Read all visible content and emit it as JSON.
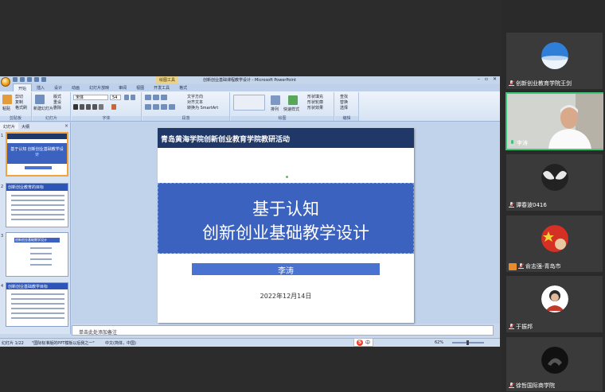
{
  "powerpoint": {
    "window_title": "创新创业基础课程教学设计 - Microsoft PowerPoint",
    "context_tab": "绘图工具",
    "window_controls": [
      "–",
      "▫",
      "✕"
    ],
    "tabs": [
      "开始",
      "插入",
      "设计",
      "动画",
      "幻灯片放映",
      "审阅",
      "视图",
      "开发工具",
      "格式"
    ],
    "active_tab": "开始",
    "ribbon": {
      "paste": "粘贴",
      "cut": "剪切",
      "copy": "复制",
      "format_painter": "格式刷",
      "new_slide": "新建幻灯片",
      "layout": "版式",
      "reset": "重设",
      "delete": "删除",
      "font_name": "宋体",
      "font_size": "54",
      "text_direction": "文字方向",
      "align_text": "对齐文本",
      "smartart": "转换为 SmartArt",
      "arrange": "排列",
      "quick_styles": "快速样式",
      "shape_fill": "形状填充",
      "shape_outline": "形状轮廓",
      "shape_effects": "形状效果",
      "find": "查找",
      "replace": "替换",
      "select": "选择",
      "groups": [
        "剪贴板",
        "幻灯片",
        "字体",
        "段落",
        "绘图",
        "编辑"
      ]
    },
    "pane_tabs": [
      "幻灯片",
      "大纲"
    ],
    "thumbnails": [
      {
        "num": "1",
        "title": "基于认知 创新创业基础教学设计"
      },
      {
        "num": "2",
        "title": "创新创业教育的目标"
      },
      {
        "num": "3",
        "title": "创新创业基础教学设计"
      },
      {
        "num": "4",
        "title": "创新创业基础教学目标"
      }
    ],
    "slide": {
      "org": "青岛黄海学院创新创业教育学院教研活动",
      "title_line1": "基于认知",
      "title_line2": "创新创业基础教学设计",
      "author": "李涛",
      "date": "2022年12月14日"
    },
    "notes_placeholder": "单击此处添加备注",
    "status": {
      "slide_info": "幻灯片 1/22",
      "theme": "\"国际标准版的PPT模板以后我之一\"",
      "language": "中文(简体，中国)",
      "zoom": "62%",
      "ime": "中"
    }
  },
  "participants": [
    {
      "name": "创新创业教育学院王剑",
      "mic": "muted",
      "avatar": "globe"
    },
    {
      "name": "李涛",
      "mic": "on",
      "avatar": "video",
      "active": true
    },
    {
      "name": "谭春波0416",
      "mic": "muted",
      "avatar": "wings"
    },
    {
      "name": "俞志强-青岛市",
      "mic": "muted",
      "avatar": "flag",
      "tag": true
    },
    {
      "name": "于振邦",
      "mic": "muted",
      "avatar": "person"
    },
    {
      "name": "徐哲国际商学院",
      "mic": "muted",
      "avatar": "cat"
    }
  ],
  "colors": {
    "slide_header": "#1f3868",
    "slide_band": "#3c62c0",
    "active_speaker": "#3cc776"
  }
}
